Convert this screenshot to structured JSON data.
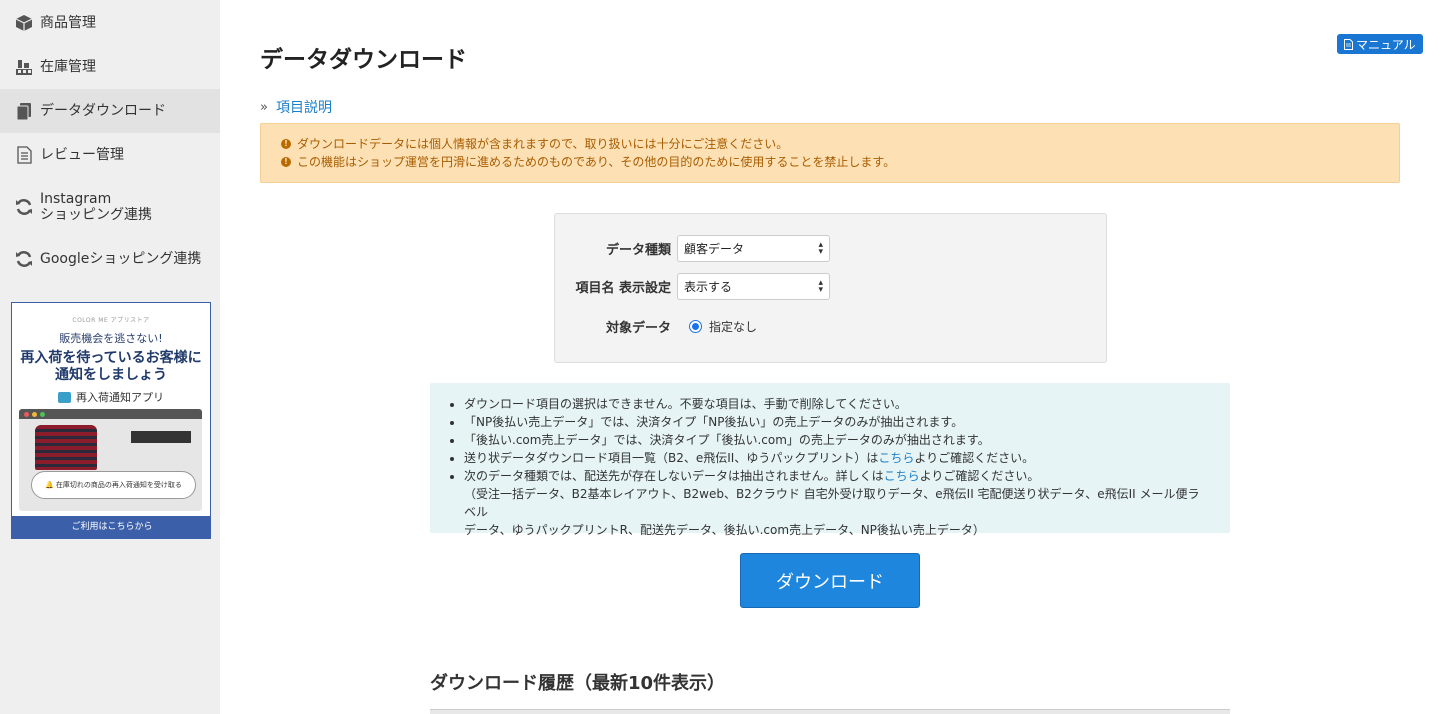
{
  "sidebar": {
    "items": [
      {
        "label": "商品管理",
        "icon": "box-icon"
      },
      {
        "label": "在庫管理",
        "icon": "stock-icon"
      },
      {
        "label": "データダウンロード",
        "icon": "documents-icon",
        "active": true
      },
      {
        "label": "レビュー管理",
        "icon": "document-icon"
      },
      {
        "label": "Instagram",
        "label2": "ショッピング連携",
        "icon": "sync-icon"
      },
      {
        "label": "Googleショッピング連携",
        "icon": "sync-icon"
      }
    ],
    "banner": {
      "brand": "COLOR ME アプリストア",
      "tagline": "販売機会を逃さない!",
      "headline1": "再入荷を待っているお客様に",
      "headline2": "通知をしましょう",
      "app_name": "再入荷通知アプリ",
      "pill_text": "在庫切れの商品の再入荷通知を受け取る",
      "footer": "ご利用はこちらから"
    }
  },
  "header": {
    "title": "データダウンロード",
    "manual_label": "マニュアル"
  },
  "breadcrumb": {
    "arrow": "»",
    "link": "項目説明"
  },
  "warnings": [
    "ダウンロードデータには個人情報が含まれますので、取り扱いには十分にご注意ください。",
    "この機能はショップ運営を円滑に進めるためのものであり、その他の目的のために使用することを禁止します。"
  ],
  "form": {
    "data_type_label": "データ種類",
    "data_type_value": "顧客データ",
    "header_label": "項目名 表示設定",
    "header_value": "表示する",
    "target_label": "対象データ",
    "target_option": "指定なし"
  },
  "info": {
    "line1": "ダウンロード項目の選択はできません。不要な項目は、手動で削除してください。",
    "line2": "「NP後払い売上データ」では、決済タイプ「NP後払い」の売上データのみが抽出されます。",
    "line3": "「後払い.com売上データ」では、決済タイプ「後払い.com」の売上データのみが抽出されます。",
    "line4_pre": "送り状データダウンロード項目一覧（B2、e飛伝II、ゆうパックプリント）は",
    "line4_link": "こちら",
    "line4_post": "よりご確認ください。",
    "line5_pre": "次のデータ種類では、配送先が存在しないデータは抽出されません。詳しくは",
    "line5_link": "こちら",
    "line5_post": "よりご確認ください。",
    "line6": "（受注一括データ、B2基本レイアウト、B2web、B2クラウド 自宅外受け取りデータ、e飛伝II 宅配便送り状データ、e飛伝II メール便ラベル",
    "line7": "データ、ゆうパックプリントR、配送先データ、後払い.com売上データ、NP後払い売上データ）"
  },
  "download_label": "ダウンロード",
  "history_title": "ダウンロード履歴（最新10件表示）"
}
